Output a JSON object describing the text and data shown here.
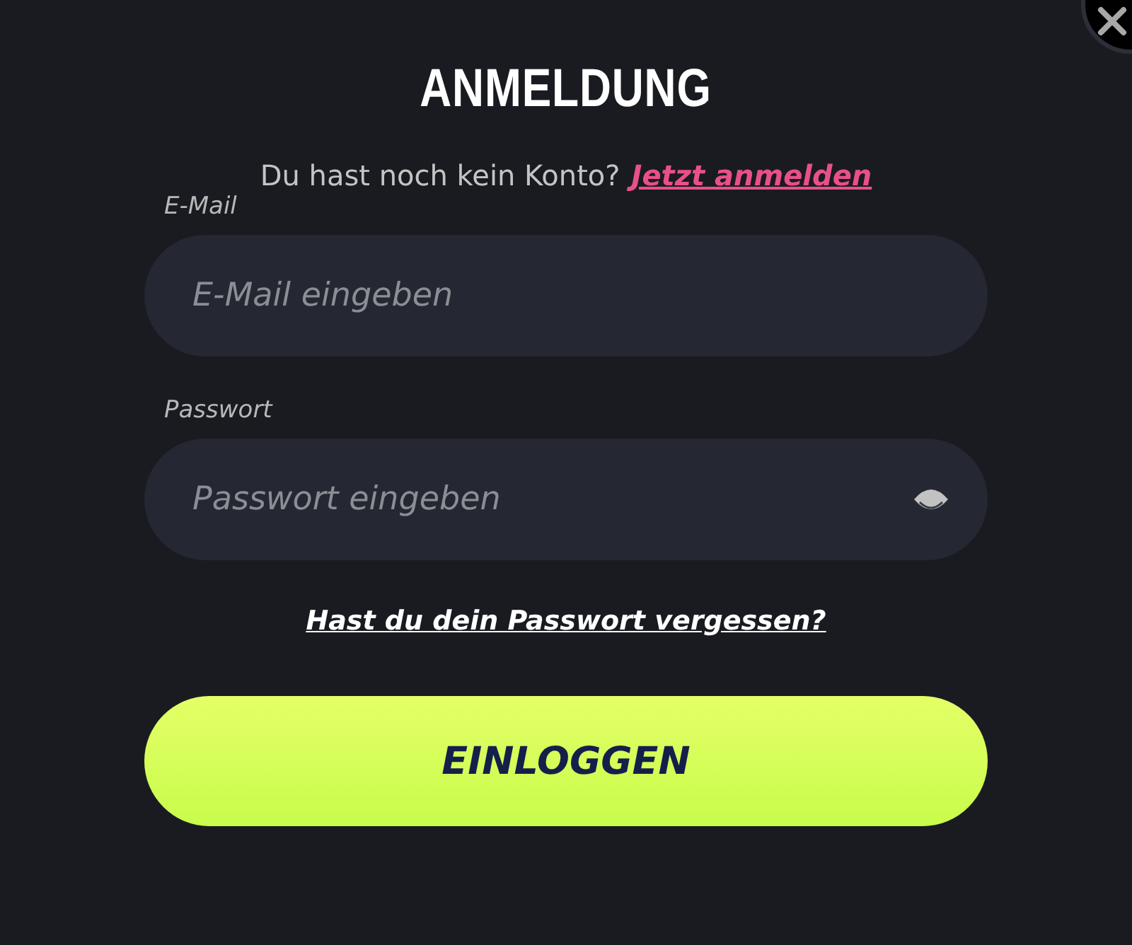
{
  "title": "ANMELDUNG",
  "signup": {
    "text": "Du hast noch kein Konto?",
    "link": "Jetzt anmelden"
  },
  "fields": [
    {
      "label": "E-Mail",
      "placeholder": "E-Mail eingeben",
      "kind": "text"
    },
    {
      "label": "Passwort",
      "placeholder": "Passwort eingeben",
      "kind": "password"
    }
  ],
  "forgot_link": "Hast du dein Passwort vergessen?",
  "submit": "EINLOGGEN"
}
